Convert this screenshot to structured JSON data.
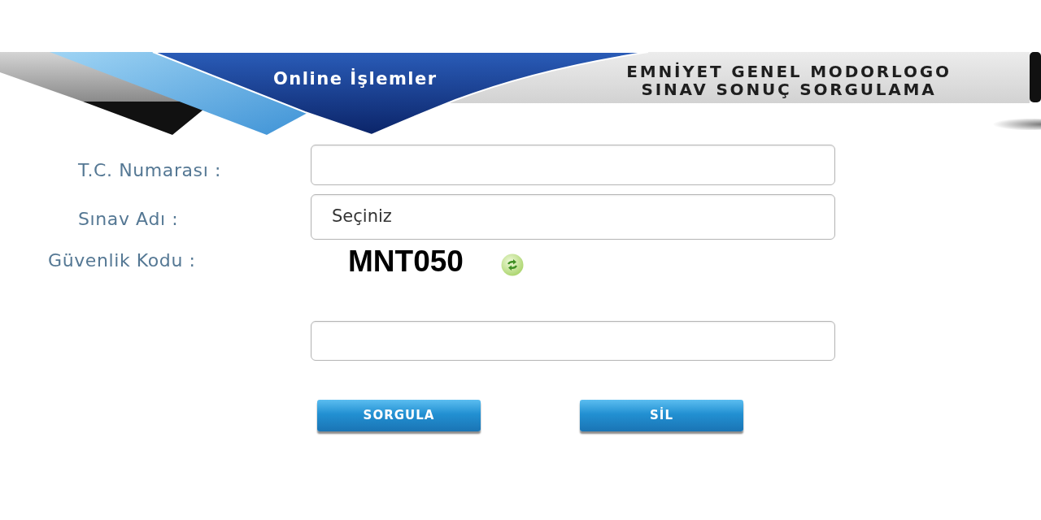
{
  "header": {
    "title": "Online İşlemler",
    "heading": [
      "EMNİYET GENEL MODORLOGO",
      "SINAV SONUÇ SORGULAMA"
    ]
  },
  "form": {
    "fields": [
      {
        "kind": "text",
        "label": "T.C. Numarası :"
      },
      {
        "kind": "select",
        "label": "Sınav Adı :",
        "value": "Seçiniz"
      },
      {
        "kind": "captcha",
        "label": "Güvenlik Kodu :",
        "code": "MNT050"
      }
    ],
    "buttons": [
      {
        "label": "SORGULA"
      },
      {
        "label": "SİL"
      }
    ]
  }
}
